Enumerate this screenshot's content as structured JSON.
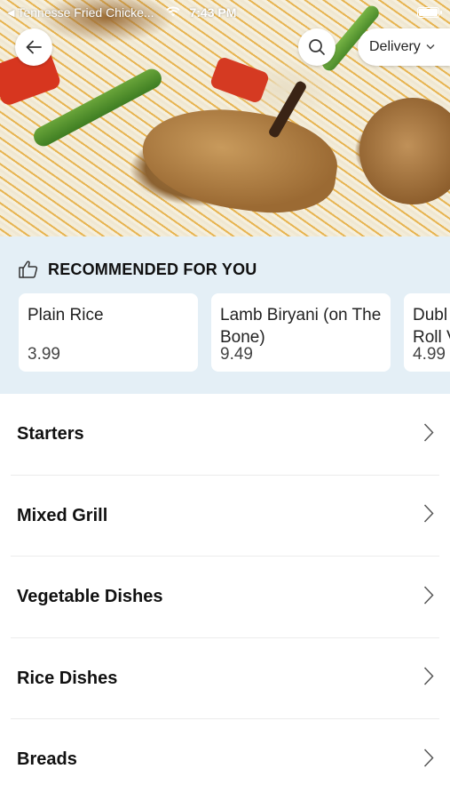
{
  "status_bar": {
    "back_app": "Tennesse Fried Chicke...",
    "time": "7:43 PM",
    "battery_level": 1.0
  },
  "header": {
    "back_icon": "arrow-left-icon",
    "search_icon": "search-icon",
    "delivery_label": "Delivery"
  },
  "recommended": {
    "title": "RECOMMENDED FOR YOU",
    "icon": "thumbs-up-icon",
    "items": [
      {
        "name": "Plain Rice",
        "price": "3.99"
      },
      {
        "name": "Lamb Biryani (on The Bone)",
        "price": "9.49"
      },
      {
        "name": "Dubl Roll V",
        "price": "4.99"
      }
    ]
  },
  "categories": [
    {
      "label": "Starters"
    },
    {
      "label": "Mixed Grill"
    },
    {
      "label": "Vegetable Dishes"
    },
    {
      "label": "Rice Dishes"
    },
    {
      "label": "Breads"
    }
  ],
  "colors": {
    "recommended_bg": "#e4eff6",
    "card_bg": "#ffffff",
    "divider": "#ececec"
  }
}
